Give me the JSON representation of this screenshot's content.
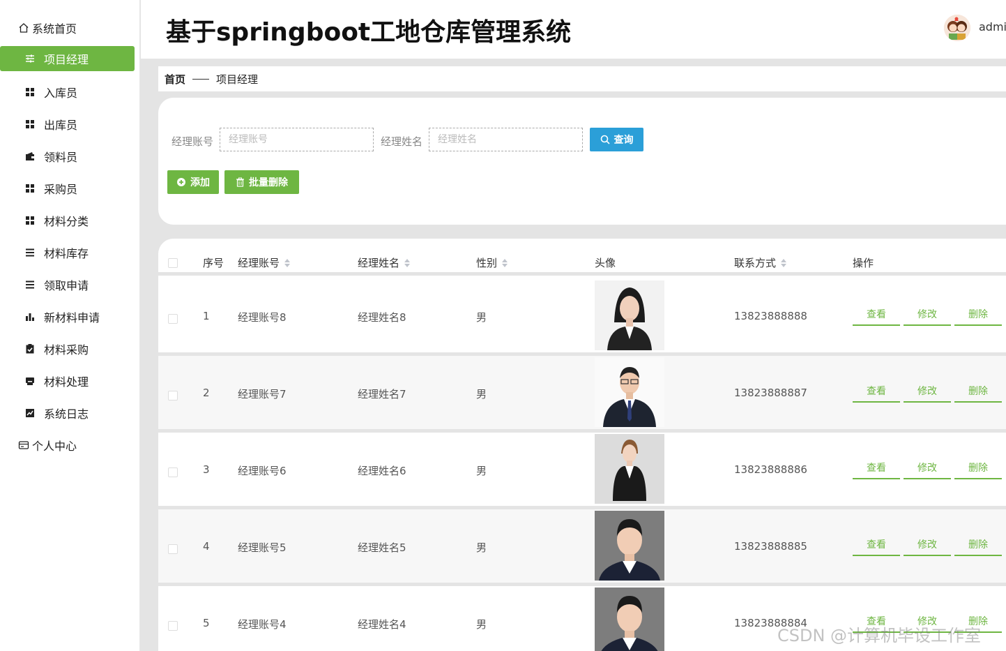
{
  "app": {
    "title": "基于springboot工地仓库管理系统",
    "username": "admi"
  },
  "sidebar": {
    "home": "系统首页",
    "items": [
      {
        "label": "项目经理",
        "icon": "sliders-icon",
        "active": true
      },
      {
        "label": "入库员",
        "icon": "grid-icon"
      },
      {
        "label": "出库员",
        "icon": "grid-icon"
      },
      {
        "label": "领料员",
        "icon": "wallet-icon"
      },
      {
        "label": "采购员",
        "icon": "grid-icon"
      },
      {
        "label": "材料分类",
        "icon": "grid-icon"
      },
      {
        "label": "材料库存",
        "icon": "list-icon"
      },
      {
        "label": "领取申请",
        "icon": "list-icon"
      },
      {
        "label": "新材料申请",
        "icon": "bar-chart-icon"
      },
      {
        "label": "材料采购",
        "icon": "clipboard-check-icon"
      },
      {
        "label": "材料处理",
        "icon": "printer-icon"
      },
      {
        "label": "系统日志",
        "icon": "line-chart-icon"
      }
    ],
    "profile": "个人中心"
  },
  "breadcrumb": {
    "home": "首页",
    "current": "项目经理"
  },
  "search": {
    "account_label": "经理账号",
    "account_placeholder": "经理账号",
    "name_label": "经理姓名",
    "name_placeholder": "经理姓名",
    "query_button": "查询",
    "add_button": "添加",
    "batch_delete_button": "批量删除"
  },
  "table": {
    "columns": {
      "index": "序号",
      "account": "经理账号",
      "name": "经理姓名",
      "gender": "性别",
      "avatar": "头像",
      "phone": "联系方式",
      "actions": "操作"
    },
    "rows": [
      {
        "index": "1",
        "account": "经理账号8",
        "name": "经理姓名8",
        "gender": "男",
        "phone": "13823888888"
      },
      {
        "index": "2",
        "account": "经理账号7",
        "name": "经理姓名7",
        "gender": "男",
        "phone": "13823888887"
      },
      {
        "index": "3",
        "account": "经理账号6",
        "name": "经理姓名6",
        "gender": "男",
        "phone": "13823888886"
      },
      {
        "index": "4",
        "account": "经理账号5",
        "name": "经理姓名5",
        "gender": "男",
        "phone": "13823888885"
      },
      {
        "index": "5",
        "account": "经理账号4",
        "name": "经理姓名4",
        "gender": "男",
        "phone": "13823888884"
      }
    ],
    "action_labels": {
      "view": "查看",
      "edit": "修改",
      "delete": "删除"
    }
  },
  "watermark": "CSDN @计算机毕设工作室",
  "colors": {
    "accent": "#6eb642",
    "query": "#2b9fd8"
  }
}
